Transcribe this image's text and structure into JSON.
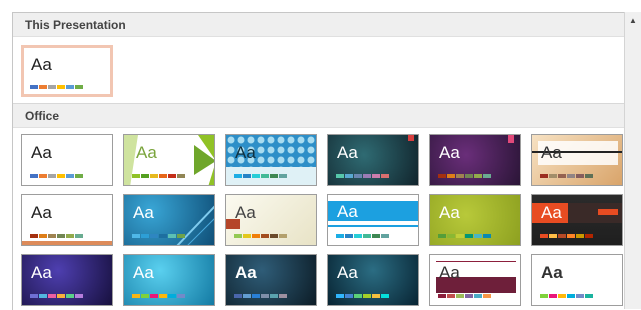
{
  "sections": {
    "current": {
      "label": "This Presentation"
    },
    "office": {
      "label": "Office"
    }
  },
  "current_theme": {
    "aa": "Aa",
    "swatches": [
      "#4472c4",
      "#ed7d31",
      "#a5a5a5",
      "#ffc000",
      "#5b9bd5",
      "#70ad47"
    ]
  },
  "themes": [
    {
      "aa": "Aa",
      "aa_color": "#222222",
      "bg": "#ffffff",
      "swatches": [
        "#4472c4",
        "#ed7d31",
        "#a5a5a5",
        "#ffc000",
        "#5b9bd5",
        "#70ad47"
      ]
    },
    {
      "aa": "Aa",
      "aa_color": "#7aa43c",
      "bg": "#ffffff",
      "swatches": [
        "#90c226",
        "#54a021",
        "#e6b91e",
        "#e76618",
        "#c42f1a",
        "#918655"
      ]
    },
    {
      "aa": "Aa",
      "aa_color": "#10313f",
      "bg": "#dff1f6",
      "swatches": [
        "#1cade4",
        "#2683c6",
        "#27ced7",
        "#42ba97",
        "#3e8853",
        "#62a39f"
      ]
    },
    {
      "aa": "Aa",
      "aa_color": "#ffffff",
      "bg": "#1f3a44",
      "swatches": [
        "#56c7aa",
        "#59a8d1",
        "#6a86b0",
        "#9b7bb4",
        "#cb7dac",
        "#d86f6f"
      ]
    },
    {
      "aa": "Aa",
      "aa_color": "#ffffff",
      "bg": "#3a1f4c",
      "swatches": [
        "#a53010",
        "#de7e18",
        "#9f8351",
        "#728653",
        "#92aa4c",
        "#6aac91"
      ]
    },
    {
      "aa": "Aa",
      "aa_color": "#333333",
      "bg": "#f2d9b8",
      "swatches": [
        "#9b2d1f",
        "#a28e6a",
        "#956251",
        "#918485",
        "#855d5d",
        "#5e7056"
      ]
    },
    {
      "aa": "Aa",
      "aa_color": "#222222",
      "bg": "#ffffff",
      "swatches": [
        "#a53010",
        "#de7e18",
        "#9f8351",
        "#728653",
        "#92aa4c",
        "#6aac91"
      ]
    },
    {
      "aa": "Aa",
      "aa_color": "#ffffff",
      "bg": "#1e6f98",
      "swatches": [
        "#4fb8e8",
        "#2d9fd6",
        "#2e86c1",
        "#1d6fa0",
        "#5cc0b3",
        "#6ea24b"
      ]
    },
    {
      "aa": "Aa",
      "aa_color": "#444444",
      "bg": "#f4f1e4",
      "swatches": [
        "#94c954",
        "#e3c81c",
        "#f07f09",
        "#a34d1e",
        "#6b4a2b",
        "#b3a06d"
      ]
    },
    {
      "aa": "Aa",
      "aa_color": "#ffffff",
      "bg": "#ffffff",
      "swatches": [
        "#1cade4",
        "#2683c6",
        "#27ced7",
        "#42ba97",
        "#3e8853",
        "#62a39f"
      ]
    },
    {
      "aa": "Aa",
      "aa_color": "#ffffff",
      "bg": "#a2b72c",
      "swatches": [
        "#549e39",
        "#8ab833",
        "#c0cf3a",
        "#029676",
        "#4ab5c4",
        "#0989b1"
      ]
    },
    {
      "aa": "Aa",
      "aa_color": "#ffffff",
      "bg": "#2b2b2b",
      "swatches": [
        "#e84c22",
        "#ffbd47",
        "#b64926",
        "#ff8427",
        "#cc9900",
        "#b22600"
      ]
    },
    {
      "aa": "Aa",
      "aa_color": "#ffffff",
      "bg": "#241a5c",
      "swatches": [
        "#6f6fd4",
        "#52b6e0",
        "#ec5fa1",
        "#f7b13d",
        "#5ad08a",
        "#b67ddc"
      ]
    },
    {
      "aa": "Aa",
      "aa_color": "#ffffff",
      "bg": "#1d8fb5",
      "swatches": [
        "#f7b615",
        "#7fd13b",
        "#ea157a",
        "#feb80a",
        "#00addc",
        "#738ac8"
      ]
    },
    {
      "aa": "Aa",
      "aa_color": "#ffffff",
      "bg": "#172e3b",
      "swatches": [
        "#4a66ac",
        "#629dd1",
        "#297fd5",
        "#7f8fa9",
        "#5aa2ae",
        "#9d90a0"
      ]
    },
    {
      "aa": "Aa",
      "aa_color": "#ffffff",
      "bg": "#0f3a4e",
      "swatches": [
        "#31b6fd",
        "#4584d3",
        "#5bd078",
        "#a5d028",
        "#f5c040",
        "#05e0db"
      ]
    },
    {
      "aa": "Aa",
      "aa_color": "#333333",
      "bg": "#ffffff",
      "swatches": [
        "#8c1f3c",
        "#c0504d",
        "#9bbb59",
        "#8064a2",
        "#4bacc6",
        "#f79646"
      ]
    },
    {
      "aa": "Aa",
      "aa_color": "#333333",
      "bg": "#ffffff",
      "swatches": [
        "#7fd13b",
        "#ea157a",
        "#feb80a",
        "#00addc",
        "#738ac8",
        "#1ab39f"
      ]
    }
  ]
}
